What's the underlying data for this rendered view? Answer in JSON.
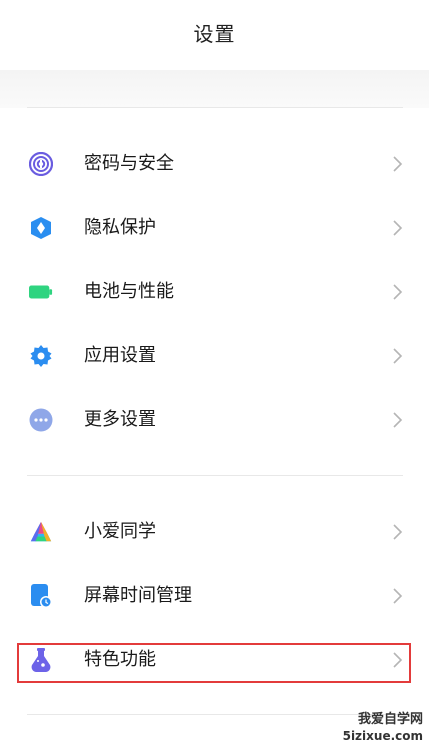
{
  "header": {
    "title": "设置"
  },
  "section1": [
    {
      "label": "密码与安全",
      "icon": "fingerprint-icon",
      "color": "#6a5ce0"
    },
    {
      "label": "隐私保护",
      "icon": "privacy-shield-icon",
      "color": "#2a8ef0"
    },
    {
      "label": "电池与性能",
      "icon": "battery-icon",
      "color": "#2fd480"
    },
    {
      "label": "应用设置",
      "icon": "gear-icon",
      "color": "#2b8df0"
    },
    {
      "label": "更多设置",
      "icon": "more-dots-icon",
      "color": "#8fa7e8"
    }
  ],
  "section2": [
    {
      "label": "小爱同学",
      "icon": "xiaoai-icon",
      "color": "#5b6cf0"
    },
    {
      "label": "屏幕时间管理",
      "icon": "screen-time-icon",
      "color": "#2b8df0"
    },
    {
      "label": "特色功能",
      "icon": "flask-icon",
      "color": "#6d63e8"
    }
  ],
  "watermark": {
    "text": "我爱自学网",
    "url": "5izixue.com"
  },
  "colors": {
    "highlight": "#e33b3b",
    "divider": "#e8e8e8"
  }
}
